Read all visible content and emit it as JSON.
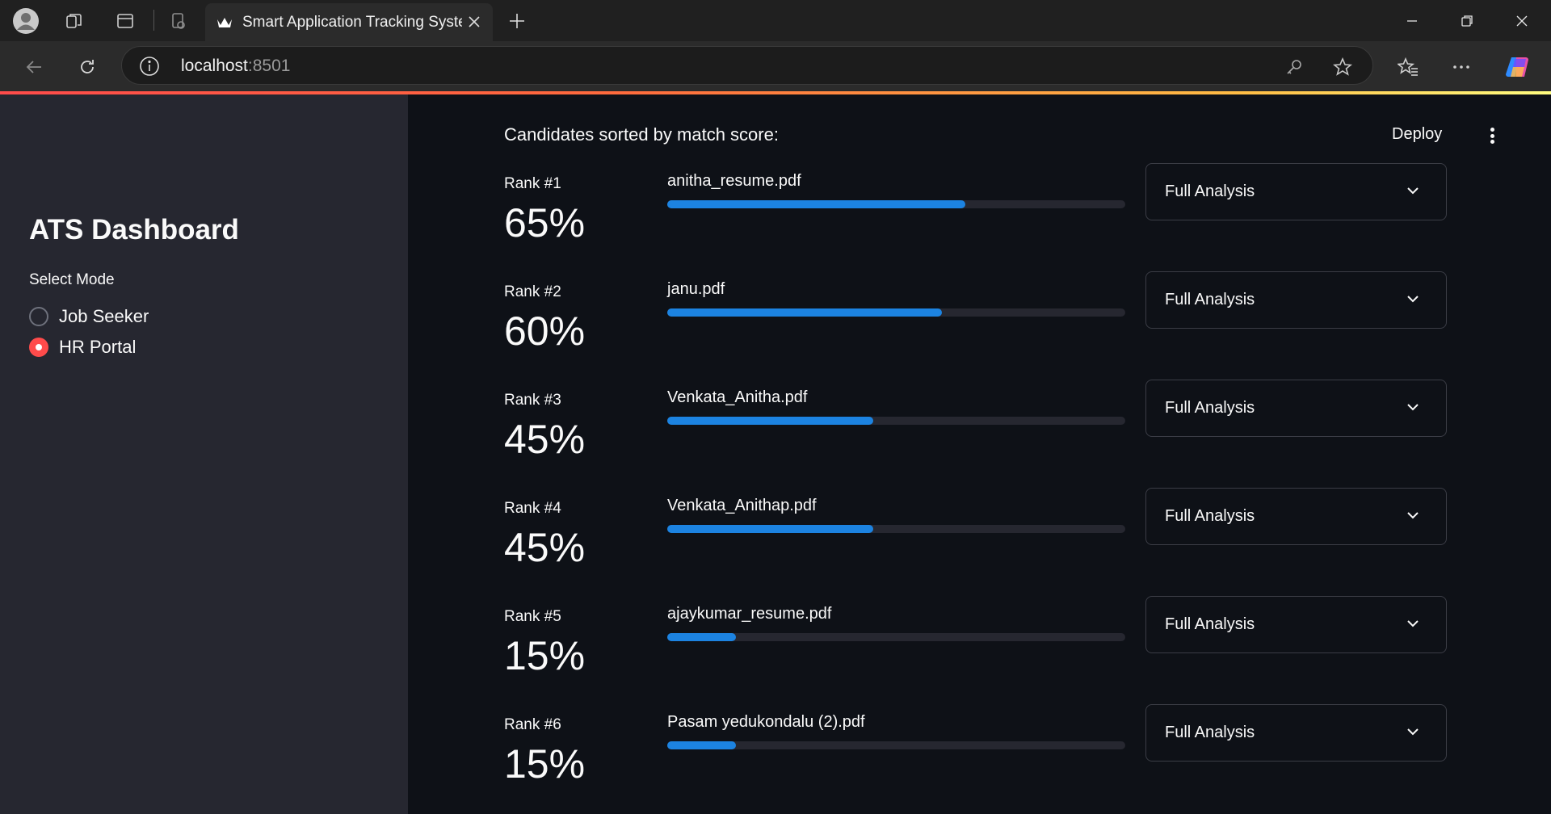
{
  "browser": {
    "tab_title": "Smart Application Tracking System",
    "url_host": "localhost",
    "url_port": ":8501"
  },
  "sidebar": {
    "title": "ATS Dashboard",
    "mode_label": "Select Mode",
    "options": [
      {
        "label": "Job Seeker",
        "selected": false
      },
      {
        "label": "HR Portal",
        "selected": true
      }
    ]
  },
  "header": {
    "deploy_label": "Deploy"
  },
  "main": {
    "subheading": "Candidates sorted by match score:",
    "expander_label": "Full Analysis",
    "candidates": [
      {
        "rank": "Rank #1",
        "score": "65%",
        "file": "anitha_resume.pdf",
        "match": 0.65
      },
      {
        "rank": "Rank #2",
        "score": "60%",
        "file": "janu.pdf",
        "match": 0.6
      },
      {
        "rank": "Rank #3",
        "score": "45%",
        "file": "Venkata_Anitha.pdf",
        "match": 0.45
      },
      {
        "rank": "Rank #4",
        "score": "45%",
        "file": "Venkata_Anithap.pdf",
        "match": 0.45
      },
      {
        "rank": "Rank #5",
        "score": "15%",
        "file": "ajaykumar_resume.pdf",
        "match": 0.15
      },
      {
        "rank": "Rank #6",
        "score": "15%",
        "file": "Pasam yedukondalu (2).pdf",
        "match": 0.15
      }
    ]
  },
  "colors": {
    "accent": "#ff4b4b",
    "progress": "#1c83e1",
    "sidebar_bg": "#262730",
    "main_bg": "#0e1117"
  },
  "icons": [
    "profile-icon",
    "workspaces-icon",
    "tab-actions-icon",
    "browser-essentials-icon",
    "streamlit-crown-icon",
    "close-icon",
    "plus-icon",
    "minimize-icon",
    "restore-icon",
    "window-close-icon",
    "back-icon",
    "refresh-icon",
    "info-icon",
    "key-icon",
    "star-icon",
    "favorites-icon",
    "more-icon",
    "copilot-icon",
    "chevron-down-icon",
    "kebab-menu-icon"
  ]
}
